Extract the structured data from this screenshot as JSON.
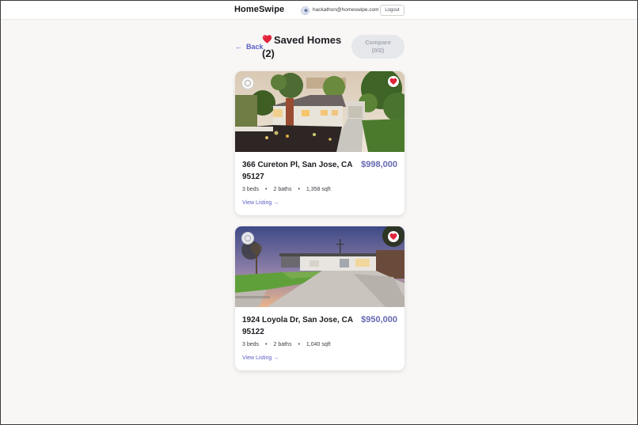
{
  "header": {
    "brand": "HomeSwipe",
    "user_email": "hackathon@homeswipe.com",
    "logout_label": "Logout"
  },
  "toolbar": {
    "back_label": "Back",
    "title": "Saved Homes",
    "count": "(2)",
    "compare_label": "Compare",
    "compare_count": "(0/2)"
  },
  "listings": [
    {
      "address": "366 Cureton Pl, San Jose, CA 95127",
      "price": "$998,000",
      "beds": "3 beds",
      "baths": "2 baths",
      "sqft": "1,358 sqft",
      "link": "View Listing →",
      "selected": false,
      "favorited": true
    },
    {
      "address": "1924 Loyola Dr, San Jose, CA 95122",
      "price": "$950,000",
      "beds": "3 beds",
      "baths": "2 baths",
      "sqft": "1,040 sqft",
      "link": "View Listing →",
      "selected": false,
      "favorited": true
    }
  ],
  "colors": {
    "accent": "#5b5dc7",
    "price": "#6568b0",
    "background": "#f8f7f5",
    "favorite": "#e0243a"
  }
}
